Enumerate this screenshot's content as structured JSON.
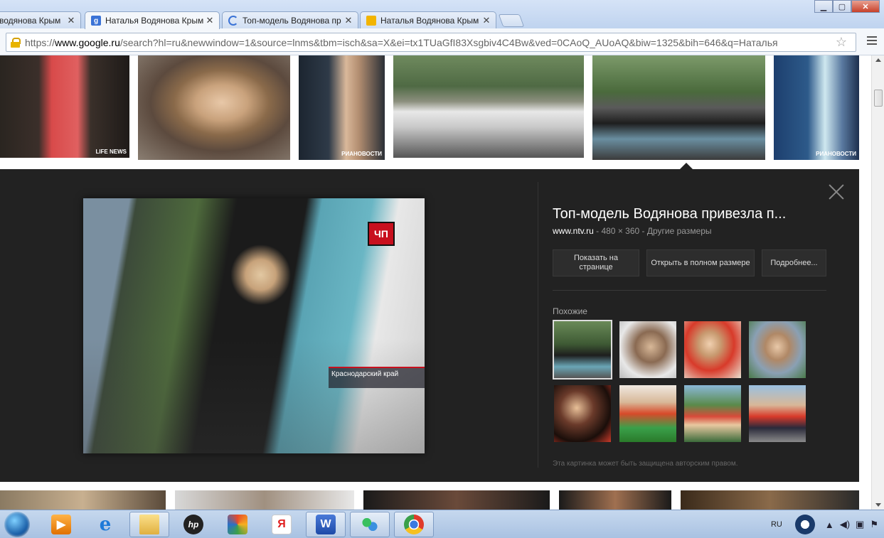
{
  "browser": {
    "tabs": [
      {
        "title": "водянова Крым",
        "active": false
      },
      {
        "title": "Наталья Водянова Крым",
        "active": true
      },
      {
        "title": "Топ-модель Водянова пр",
        "active": false
      },
      {
        "title": "Наталья Водянова Крым",
        "active": false
      }
    ],
    "close_glyph": "✕",
    "window_buttons": {
      "minimize": "▁",
      "maximize": "▢",
      "close": "✕"
    },
    "url_prefix": "https://",
    "url_host": "www.google.ru",
    "url_rest": "/search?hl=ru&newwindow=1&source=lnms&tbm=isch&sa=X&ei=tx1TUaGfI83Xsgbiv4C4Bw&ved=0CAoQ_AUoAQ&biw=1325&bih=646&q=Наталья",
    "star_glyph": "☆"
  },
  "results_row": {
    "watermarks": {
      "lifenews": "LIFE NEWS",
      "rianovosti": "РИАНОВОСТИ"
    }
  },
  "preview": {
    "overlay_badge": "ЧП",
    "overlay_location": "Краснодарский край",
    "title": "Топ-модель Водянова привезла п...",
    "source_host": "www.ntv.ru",
    "source_meta": " - 480 × 360 - Другие размеры",
    "buttons": {
      "visit_page": "Показать на странице",
      "open_full": "Открыть в полном размере",
      "more": "Подробнее..."
    },
    "similar_label": "Похожие",
    "copyright": "Эта картинка может быть защищена авторским правом."
  },
  "taskbar": {
    "language": "RU",
    "word_glyph": "W",
    "yandex_glyph": "Я",
    "hp_glyph": "hp"
  }
}
